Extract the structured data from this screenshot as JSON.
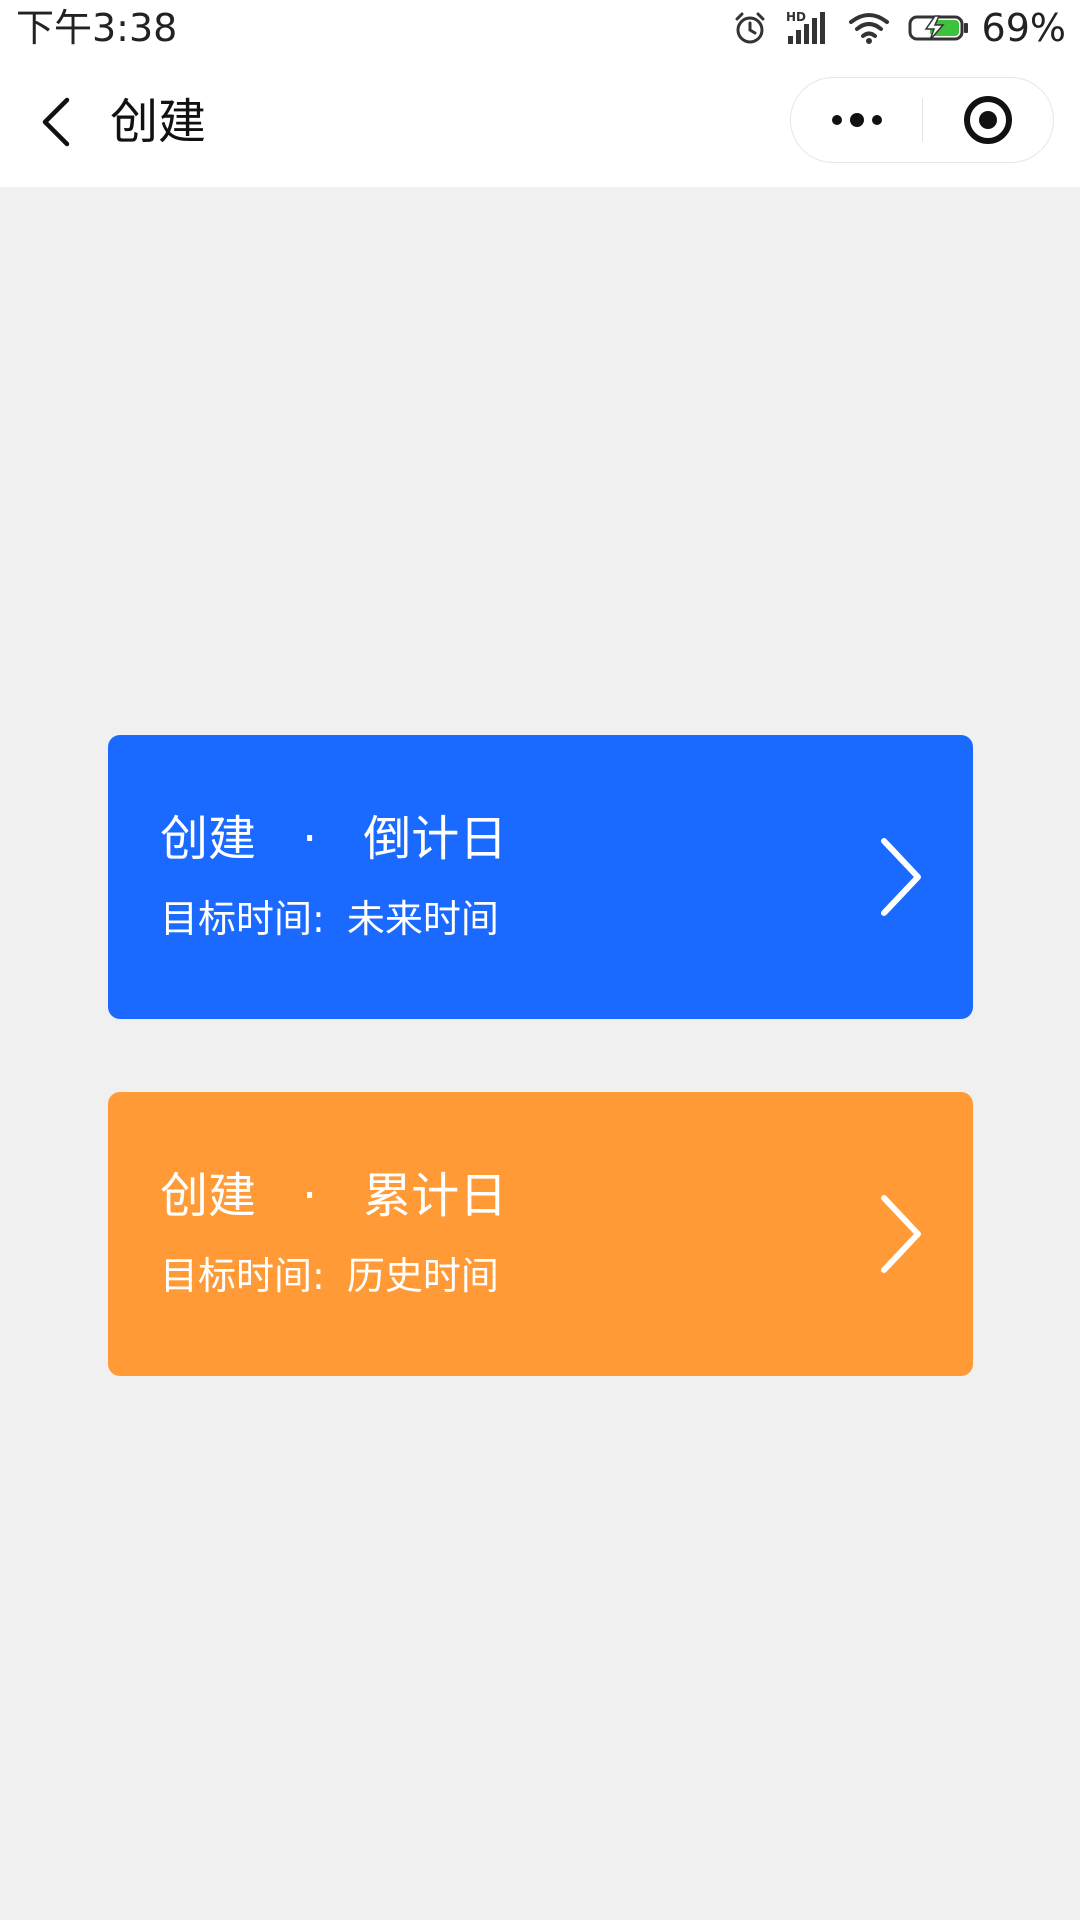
{
  "status_bar": {
    "time": "下午3:38",
    "signal_label": "HD",
    "battery_percent": "69%",
    "icons": [
      "alarm-icon",
      "signal-icon",
      "wifi-icon",
      "battery-charging-icon"
    ]
  },
  "nav": {
    "title": "创建",
    "back_icon": "chevron-left-icon",
    "more_icon": "more-dots-icon",
    "close_icon": "target-close-icon"
  },
  "cards": [
    {
      "title_prefix": "创建",
      "separator": "·",
      "title_name": "倒计日",
      "sub_label": "目标时间:",
      "sub_value": "未来时间",
      "color": "#1a6aff",
      "icon": "chevron-right-icon"
    },
    {
      "title_prefix": "创建",
      "separator": "·",
      "title_name": "累计日",
      "sub_label": "目标时间:",
      "sub_value": "历史时间",
      "color": "#ff9a36",
      "icon": "chevron-right-icon"
    }
  ],
  "colors": {
    "background": "#f0f0f0",
    "header": "#ffffff",
    "text": "#111111",
    "card_text": "#ffffff"
  }
}
